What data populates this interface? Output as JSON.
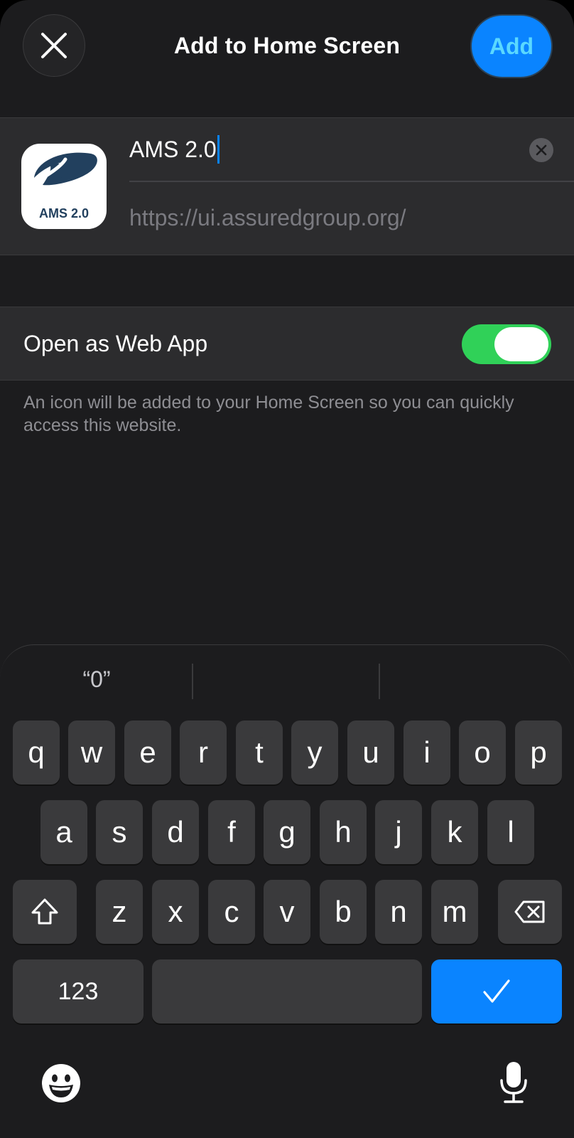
{
  "header": {
    "title": "Add to Home Screen",
    "close_icon": "close-icon",
    "add_label": "Add"
  },
  "shortcut": {
    "icon_label": "AMS 2.0",
    "name_value": "AMS 2.0",
    "url": "https://ui.assuredgroup.org/"
  },
  "web_app": {
    "label": "Open as Web App",
    "enabled": true,
    "footnote": "An icon will be added to your Home Screen so you can quickly access this website."
  },
  "keyboard": {
    "suggestions": [
      "“0”",
      "",
      ""
    ],
    "row1": [
      "q",
      "w",
      "e",
      "r",
      "t",
      "y",
      "u",
      "i",
      "o",
      "p"
    ],
    "row2": [
      "a",
      "s",
      "d",
      "f",
      "g",
      "h",
      "j",
      "k",
      "l"
    ],
    "row3": [
      "z",
      "x",
      "c",
      "v",
      "b",
      "n",
      "m"
    ],
    "numbers_label": "123",
    "shift_icon": "shift-icon",
    "delete_icon": "delete-icon",
    "done_icon": "checkmark-icon",
    "emoji_icon": "emoji-icon",
    "mic_icon": "microphone-icon"
  },
  "colors": {
    "accent": "#0a84ff",
    "toggle_on": "#30d158",
    "background": "#1c1c1e",
    "cell": "#2c2c2e"
  }
}
